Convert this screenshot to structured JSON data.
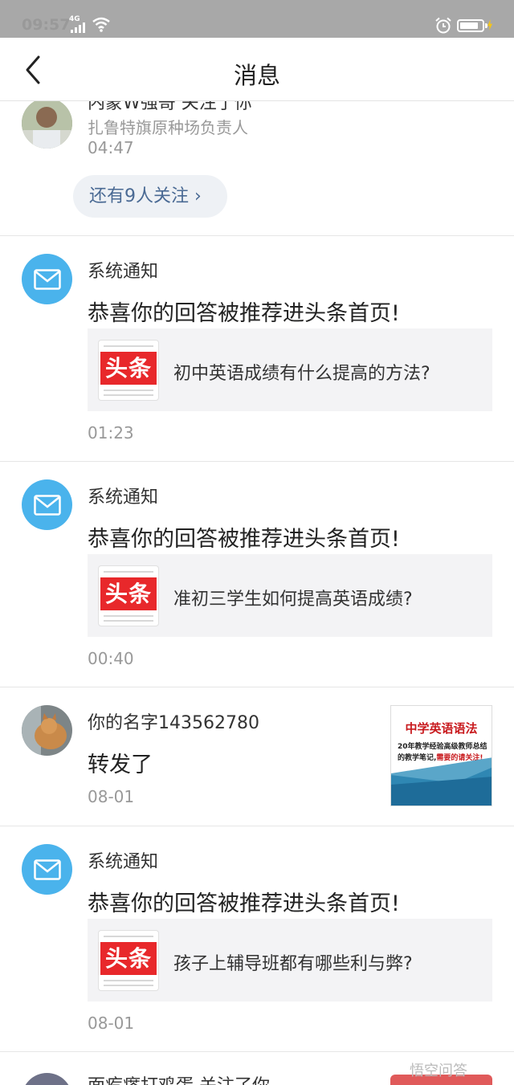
{
  "status_bar": {
    "time": "09:57",
    "network": "4G",
    "icons": [
      "signal-icon",
      "wifi-icon",
      "alarm-icon",
      "battery-icon"
    ]
  },
  "nav": {
    "back_icon": "chevron-left-icon",
    "title": "消息"
  },
  "follow_item": {
    "title": "内蒙W强哥 关注了你",
    "subtitle": "扎鲁特旗原种场负责人",
    "time": "04:47",
    "more_label": "还有9人关注 ›"
  },
  "notifications": [
    {
      "sender": "系统通知",
      "message": "恭喜你的回答被推荐进头条首页!",
      "card_logo": "头条",
      "card_text": "初中英语成绩有什么提高的方法?",
      "time": "01:23"
    },
    {
      "sender": "系统通知",
      "message": "恭喜你的回答被推荐进头条首页!",
      "card_logo": "头条",
      "card_text": "准初三学生如何提高英语成绩?",
      "time": "00:40"
    },
    {
      "sender": "你的名字143562780",
      "message": "转发了",
      "time": "08-01",
      "thumb_title": "中学英语语法",
      "thumb_text": "20年教学经验高级教师总结的教学笔记,",
      "thumb_highlight": "需要的请关注!"
    },
    {
      "sender": "系统通知",
      "message": "恭喜你的回答被推荐进头条首页!",
      "card_logo": "头条",
      "card_text": "孩子上辅导班都有哪些利与弊?",
      "time": "08-01"
    }
  ],
  "partial_item": {
    "title": "面疙瘩打鸡蛋 关注了你"
  },
  "watermark": "悟空问答",
  "colors": {
    "status_bar": "#a8a8a8",
    "mail_avatar": "#4ab3ec",
    "toutiao_red": "#e8282b",
    "pill_text": "#4a6a94"
  }
}
